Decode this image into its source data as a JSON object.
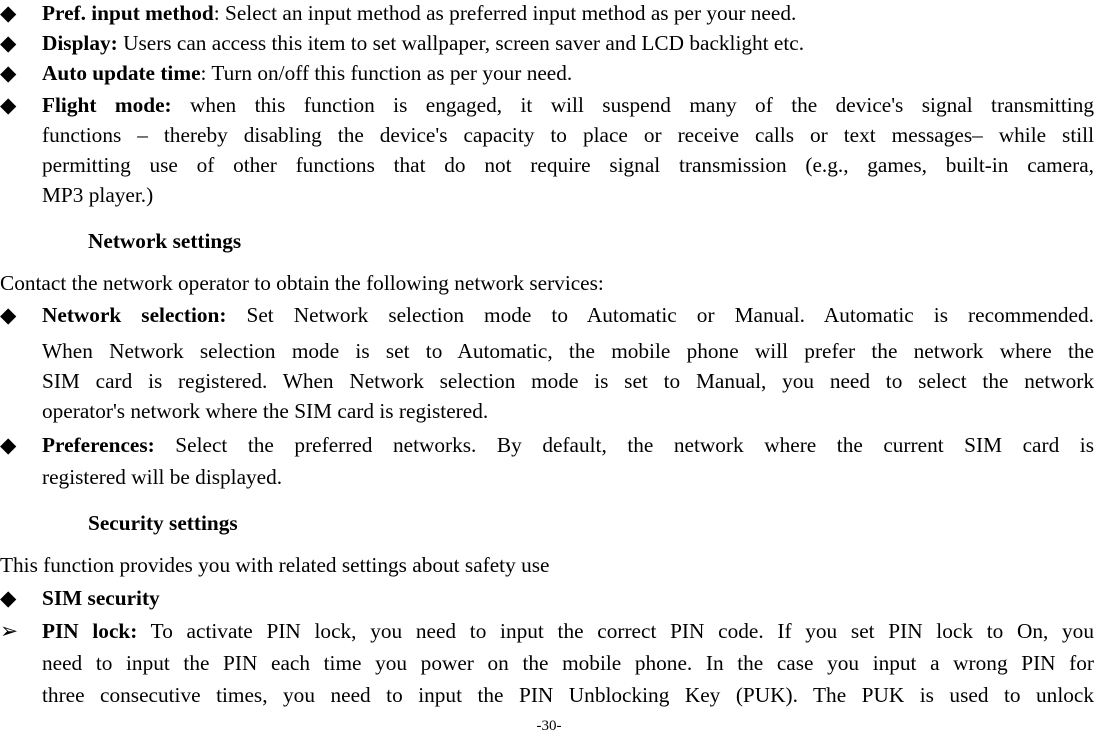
{
  "items": [
    {
      "bold": "Pref. input method",
      "rest": ": Select an input method as preferred input method as per your need."
    },
    {
      "bold": "Display:",
      "rest": " Users can access this item to set wallpaper, screen saver and LCD backlight etc."
    },
    {
      "bold": "Auto update time",
      "rest": ": Turn on/off this function as per your need."
    },
    {
      "bold": "Flight mode:",
      "l1": " when this function is engaged, it will suspend many of the device's signal transmitting",
      "l2": "functions – thereby disabling the device's capacity to place or receive calls or text messages– while still",
      "l3": "permitting use of other functions that do not require signal transmission (e.g., games, built-in camera,",
      "l4": "MP3 player.)"
    }
  ],
  "network": {
    "heading": "Network settings",
    "intro": "Contact the network operator to obtain the following network services:",
    "sel_bold": "Network selection:",
    "sel1": " Set Network selection mode to Automatic or Manual. Automatic is recommended.",
    "sel2": "When Network selection mode is set to Automatic, the mobile phone will prefer the network where the",
    "sel3": "SIM card is registered. When Network selection mode is set to Manual, you need to select the network",
    "sel4": "operator's network where the SIM card is registered.",
    "pref_bold": "Preferences:",
    "pref1": " Select the preferred networks. By default, the network where the current SIM card is",
    "pref2": "registered will be displayed."
  },
  "security": {
    "heading": "Security settings",
    "intro": "This function provides you with related settings about safety use",
    "sim": "SIM security",
    "pin_bold": "PIN lock:",
    "pin1": " To activate PIN lock, you need to input the correct PIN code. If you set PIN lock to On, you",
    "pin2": "need to input the PIN each time you power on the mobile phone. In the case you input a wrong PIN for",
    "pin3": "three consecutive times, you need to input the PIN Unblocking Key (PUK). The PUK is used to unlock"
  },
  "icons": {
    "diamond": "◆",
    "arrow": "➢"
  },
  "page_number": "-30-"
}
